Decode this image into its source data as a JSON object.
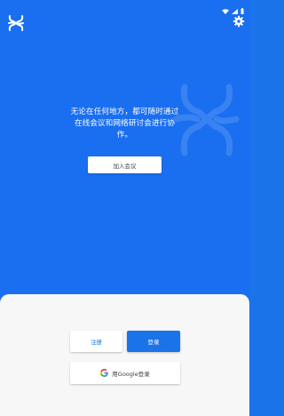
{
  "status_bar": {
    "icons": [
      "wifi-icon",
      "signal-icon",
      "battery-icon"
    ]
  },
  "header": {
    "logo_icon": "app-logo-icon",
    "settings_icon": "gear-icon"
  },
  "hero": {
    "text": "无论在任何地方，都可随时通过在线会议和网络研讨会进行协作。",
    "join_button_label": "加入会议"
  },
  "auth": {
    "signup_label": "注册",
    "login_label": "登录",
    "google_login_label": "用Google登录"
  },
  "colors": {
    "primary_blue": "#1a6ff0",
    "button_blue": "#1a73e8",
    "sheet_background": "#f7f7f7"
  }
}
